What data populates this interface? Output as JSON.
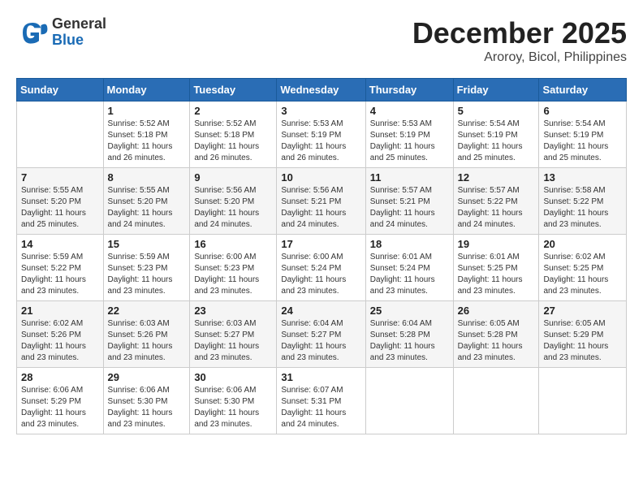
{
  "header": {
    "logo_general": "General",
    "logo_blue": "Blue",
    "month": "December 2025",
    "location": "Aroroy, Bicol, Philippines"
  },
  "days_of_week": [
    "Sunday",
    "Monday",
    "Tuesday",
    "Wednesday",
    "Thursday",
    "Friday",
    "Saturday"
  ],
  "weeks": [
    [
      {
        "day": "",
        "info": ""
      },
      {
        "day": "1",
        "info": "Sunrise: 5:52 AM\nSunset: 5:18 PM\nDaylight: 11 hours and 26 minutes."
      },
      {
        "day": "2",
        "info": "Sunrise: 5:52 AM\nSunset: 5:18 PM\nDaylight: 11 hours and 26 minutes."
      },
      {
        "day": "3",
        "info": "Sunrise: 5:53 AM\nSunset: 5:19 PM\nDaylight: 11 hours and 26 minutes."
      },
      {
        "day": "4",
        "info": "Sunrise: 5:53 AM\nSunset: 5:19 PM\nDaylight: 11 hours and 25 minutes."
      },
      {
        "day": "5",
        "info": "Sunrise: 5:54 AM\nSunset: 5:19 PM\nDaylight: 11 hours and 25 minutes."
      },
      {
        "day": "6",
        "info": "Sunrise: 5:54 AM\nSunset: 5:19 PM\nDaylight: 11 hours and 25 minutes."
      }
    ],
    [
      {
        "day": "7",
        "info": "Sunrise: 5:55 AM\nSunset: 5:20 PM\nDaylight: 11 hours and 25 minutes."
      },
      {
        "day": "8",
        "info": "Sunrise: 5:55 AM\nSunset: 5:20 PM\nDaylight: 11 hours and 24 minutes."
      },
      {
        "day": "9",
        "info": "Sunrise: 5:56 AM\nSunset: 5:20 PM\nDaylight: 11 hours and 24 minutes."
      },
      {
        "day": "10",
        "info": "Sunrise: 5:56 AM\nSunset: 5:21 PM\nDaylight: 11 hours and 24 minutes."
      },
      {
        "day": "11",
        "info": "Sunrise: 5:57 AM\nSunset: 5:21 PM\nDaylight: 11 hours and 24 minutes."
      },
      {
        "day": "12",
        "info": "Sunrise: 5:57 AM\nSunset: 5:22 PM\nDaylight: 11 hours and 24 minutes."
      },
      {
        "day": "13",
        "info": "Sunrise: 5:58 AM\nSunset: 5:22 PM\nDaylight: 11 hours and 23 minutes."
      }
    ],
    [
      {
        "day": "14",
        "info": "Sunrise: 5:59 AM\nSunset: 5:22 PM\nDaylight: 11 hours and 23 minutes."
      },
      {
        "day": "15",
        "info": "Sunrise: 5:59 AM\nSunset: 5:23 PM\nDaylight: 11 hours and 23 minutes."
      },
      {
        "day": "16",
        "info": "Sunrise: 6:00 AM\nSunset: 5:23 PM\nDaylight: 11 hours and 23 minutes."
      },
      {
        "day": "17",
        "info": "Sunrise: 6:00 AM\nSunset: 5:24 PM\nDaylight: 11 hours and 23 minutes."
      },
      {
        "day": "18",
        "info": "Sunrise: 6:01 AM\nSunset: 5:24 PM\nDaylight: 11 hours and 23 minutes."
      },
      {
        "day": "19",
        "info": "Sunrise: 6:01 AM\nSunset: 5:25 PM\nDaylight: 11 hours and 23 minutes."
      },
      {
        "day": "20",
        "info": "Sunrise: 6:02 AM\nSunset: 5:25 PM\nDaylight: 11 hours and 23 minutes."
      }
    ],
    [
      {
        "day": "21",
        "info": "Sunrise: 6:02 AM\nSunset: 5:26 PM\nDaylight: 11 hours and 23 minutes."
      },
      {
        "day": "22",
        "info": "Sunrise: 6:03 AM\nSunset: 5:26 PM\nDaylight: 11 hours and 23 minutes."
      },
      {
        "day": "23",
        "info": "Sunrise: 6:03 AM\nSunset: 5:27 PM\nDaylight: 11 hours and 23 minutes."
      },
      {
        "day": "24",
        "info": "Sunrise: 6:04 AM\nSunset: 5:27 PM\nDaylight: 11 hours and 23 minutes."
      },
      {
        "day": "25",
        "info": "Sunrise: 6:04 AM\nSunset: 5:28 PM\nDaylight: 11 hours and 23 minutes."
      },
      {
        "day": "26",
        "info": "Sunrise: 6:05 AM\nSunset: 5:28 PM\nDaylight: 11 hours and 23 minutes."
      },
      {
        "day": "27",
        "info": "Sunrise: 6:05 AM\nSunset: 5:29 PM\nDaylight: 11 hours and 23 minutes."
      }
    ],
    [
      {
        "day": "28",
        "info": "Sunrise: 6:06 AM\nSunset: 5:29 PM\nDaylight: 11 hours and 23 minutes."
      },
      {
        "day": "29",
        "info": "Sunrise: 6:06 AM\nSunset: 5:30 PM\nDaylight: 11 hours and 23 minutes."
      },
      {
        "day": "30",
        "info": "Sunrise: 6:06 AM\nSunset: 5:30 PM\nDaylight: 11 hours and 23 minutes."
      },
      {
        "day": "31",
        "info": "Sunrise: 6:07 AM\nSunset: 5:31 PM\nDaylight: 11 hours and 24 minutes."
      },
      {
        "day": "",
        "info": ""
      },
      {
        "day": "",
        "info": ""
      },
      {
        "day": "",
        "info": ""
      }
    ]
  ]
}
